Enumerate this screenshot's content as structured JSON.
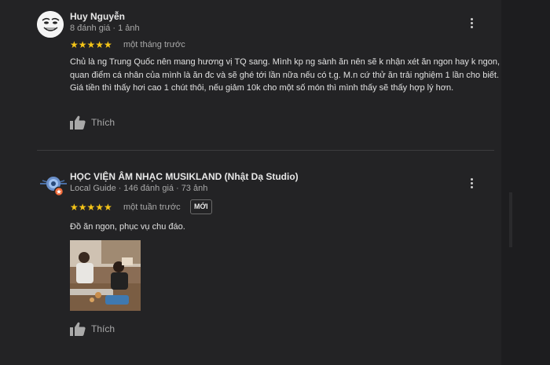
{
  "reviews": [
    {
      "reviewer_name": "Huy Nguyễn",
      "reviews_count": "8 đánh giá",
      "photos_count": "1 ảnh",
      "rating_stars": "★★★★★",
      "date": "một tháng trước",
      "text": "Chủ là ng Trung Quốc nên mang hương vị TQ sang. Mình kp ng sành ăn nên sẽ k nhận xét ăn ngon hay k ngon, quan điểm cá nhân của mình là ăn đc và sẽ ghé tới lần nữa nếu có t.g. M.n cứ thử ăn trải nghiệm 1 lần cho biết. Giá tiền thì thấy hơi cao 1 chút thôi, nếu giảm 10k cho một số món thì mình thấy sẽ thấy hợp lý hơn.",
      "like_label": "Thích"
    },
    {
      "reviewer_name": "HỌC VIỆN ÂM NHẠC MUSIKLAND (Nhật Dạ Studio)",
      "local_guide_label": "Local Guide",
      "reviews_count": "146 đánh giá",
      "photos_count": "73 ảnh",
      "rating_stars": "★★★★★",
      "date": "một tuần trước",
      "new_badge": "MỚI",
      "text": "Đồ ăn ngon, phục vụ chu đáo.",
      "like_label": "Thích"
    }
  ],
  "colors": {
    "background": "#232325",
    "star": "#f5c518",
    "text": "#e0e0e0",
    "secondary_text": "#a9a9a9"
  },
  "icons": {
    "menu": "more-vert-icon",
    "like": "thumb-up-icon",
    "local_guide": "local-guide-badge-icon"
  }
}
